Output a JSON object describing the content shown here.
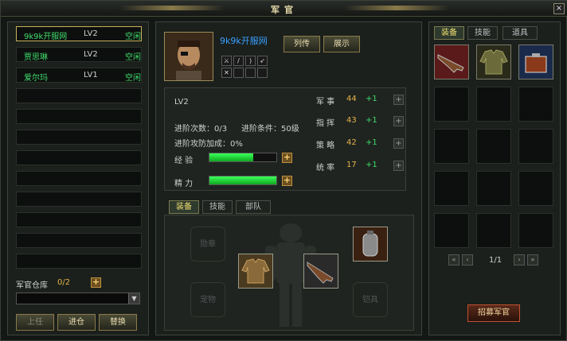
{
  "window": {
    "title": "军官",
    "close": "×"
  },
  "officers": [
    {
      "name": "9k9k开服网",
      "level": "LV2",
      "status": "空闲"
    },
    {
      "name": "贾思琳",
      "level": "LV2",
      "status": "空闲"
    },
    {
      "name": "爱尔玛",
      "level": "LV1",
      "status": "空闲"
    }
  ],
  "warehouse": {
    "label": "军官仓库",
    "count": "0/2",
    "plus": "+"
  },
  "left_buttons": {
    "hire": "上任",
    "enter": "进仓",
    "swap": "替换"
  },
  "hero": {
    "name": "9k9k开服网",
    "level": "LV2",
    "bio_button": "列传",
    "show_button": "展示"
  },
  "advance": {
    "count_label": "进阶次数：0/3",
    "cond_label": "进阶条件：50级",
    "bonus_label": "进阶攻防加成：0%"
  },
  "exp": {
    "label": "经 验",
    "fraction": 0.65
  },
  "energy": {
    "label": "精 力",
    "fraction": 1.0
  },
  "stats": [
    {
      "label": "军 事",
      "value": "44",
      "bonus": "+1"
    },
    {
      "label": "指 挥",
      "value": "43",
      "bonus": "+1"
    },
    {
      "label": "策 略",
      "value": "42",
      "bonus": "+1"
    },
    {
      "label": "统 率",
      "value": "17",
      "bonus": "+1"
    }
  ],
  "mid_tabs": [
    "装备",
    "技能",
    "部队"
  ],
  "equip_slots": {
    "medal": "勋章",
    "pet": "宠物",
    "armor": "铠具"
  },
  "right_tabs": [
    "装备",
    "技能",
    "道具"
  ],
  "pager": {
    "page": "1/1",
    "first": "«",
    "prev": "‹",
    "next": "›",
    "last": "»"
  },
  "recruit": "招募军官",
  "colors": {
    "accent": "#e6b24a",
    "green": "#3fdc6a",
    "gold_border": "#c9b25a"
  }
}
